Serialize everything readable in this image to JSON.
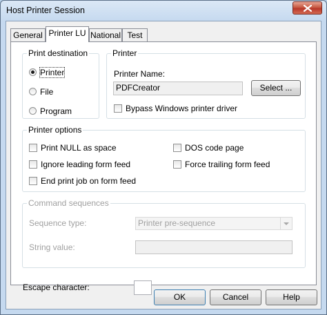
{
  "window": {
    "title": "Host Printer Session"
  },
  "tabs": [
    {
      "label": "General",
      "active": false
    },
    {
      "label": "Printer LU",
      "active": true
    },
    {
      "label": "National",
      "active": false
    },
    {
      "label": "Test",
      "active": false
    }
  ],
  "print_destination": {
    "title": "Print destination",
    "options": [
      {
        "label": "Printer",
        "selected": true
      },
      {
        "label": "File",
        "selected": false
      },
      {
        "label": "Program",
        "selected": false
      }
    ]
  },
  "printer": {
    "title": "Printer",
    "name_label": "Printer Name:",
    "name_value": "PDFCreator",
    "select_label": "Select ...",
    "bypass_label": "Bypass Windows printer driver",
    "bypass_checked": false
  },
  "printer_options": {
    "title": "Printer options",
    "options": [
      {
        "label": "Print NULL as space",
        "checked": false
      },
      {
        "label": "Ignore leading form feed",
        "checked": false
      },
      {
        "label": "End print job on form feed",
        "checked": false
      },
      {
        "label": "DOS code page",
        "checked": false
      },
      {
        "label": "Force trailing form feed",
        "checked": false
      }
    ]
  },
  "command_sequences": {
    "title": "Command sequences",
    "sequence_type_label": "Sequence type:",
    "sequence_type_value": "Printer pre-sequence",
    "string_value_label": "String value:",
    "string_value": ""
  },
  "escape": {
    "label": "Escape character:",
    "value": ""
  },
  "buttons": {
    "ok": "OK",
    "cancel": "Cancel",
    "help": "Help"
  }
}
